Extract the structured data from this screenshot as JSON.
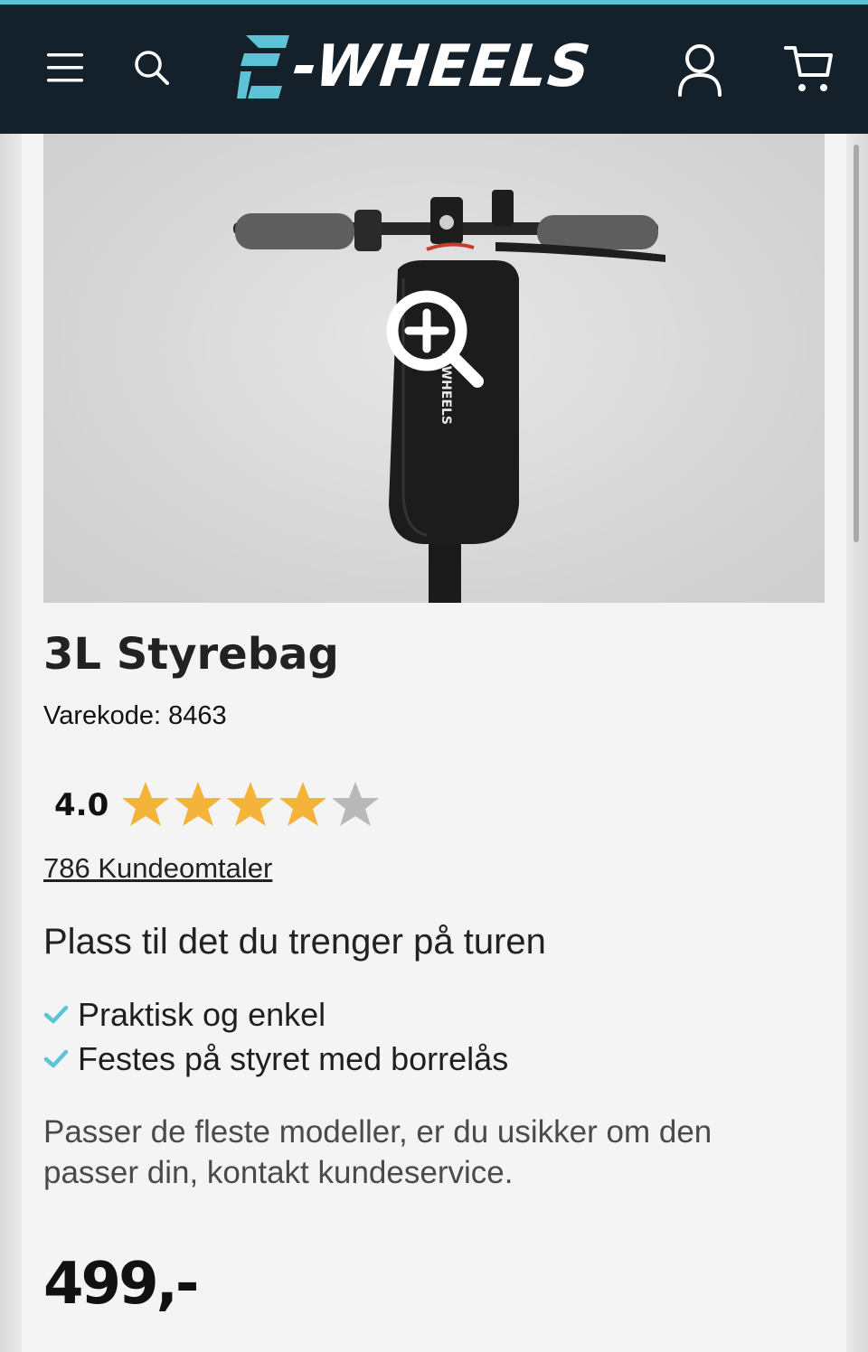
{
  "brand": {
    "name": "E-WHEELS",
    "logo_text": "-WHEELS",
    "accent_color": "#5cc4d6",
    "header_bg": "#14202a"
  },
  "header": {
    "icons": [
      "menu-icon",
      "search-icon",
      "account-icon",
      "cart-icon"
    ]
  },
  "product": {
    "title": "3L Styrebag",
    "sku_label": "Varekode: 8463",
    "image_bag_logo": "E-WHEELS",
    "rating": {
      "value_text": "4.0",
      "value": 4.0,
      "max": 5,
      "star_color": "#f4b43a",
      "empty_star_color": "#b9b9b9"
    },
    "reviews_link": "786 Kundeomtaler",
    "subtitle": "Plass til det du trenger på turen",
    "features": [
      "Praktisk og enkel",
      "Festes på styret med borrelås"
    ],
    "description": "Passer de fleste modeller, er du usikker om den passer din, kontakt kundeservice.",
    "price": "499,-"
  }
}
